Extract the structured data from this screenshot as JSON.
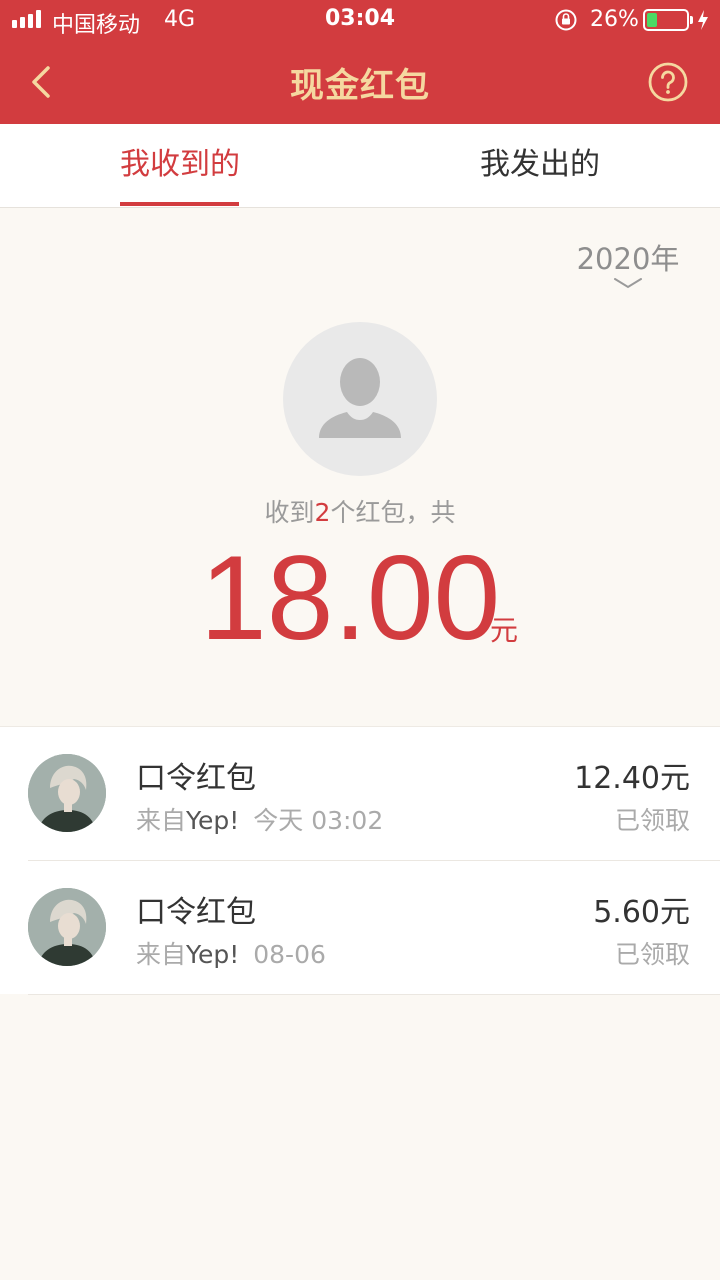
{
  "status_bar": {
    "carrier": "中国移动",
    "network": "4G",
    "time": "03:04",
    "battery_percent": "26%",
    "battery_level": 0.26
  },
  "nav": {
    "title": "现金红包",
    "back_icon": "chevron-left-icon",
    "help_icon": "question-circle-icon"
  },
  "tabs": [
    {
      "label": "我收到的",
      "active": true
    },
    {
      "label": "我发出的",
      "active": false
    }
  ],
  "year_selector": {
    "label": "2020年"
  },
  "summary": {
    "prefix": "收到",
    "count": "2",
    "suffix": "个红包，共",
    "amount": "18.00",
    "unit": "元"
  },
  "records": [
    {
      "title": "口令红包",
      "from_label": "来自",
      "sender": "Yep!",
      "time": "今天 03:02",
      "amount": "12.40元",
      "status": "已领取"
    },
    {
      "title": "口令红包",
      "from_label": "来自",
      "sender": "Yep!",
      "time": "08-06",
      "amount": "5.60元",
      "status": "已领取"
    }
  ],
  "colors": {
    "header": "#d23c3f",
    "title_gold": "#f5d8a0",
    "accent_red": "#d23c3f",
    "background": "#fbf8f3"
  }
}
